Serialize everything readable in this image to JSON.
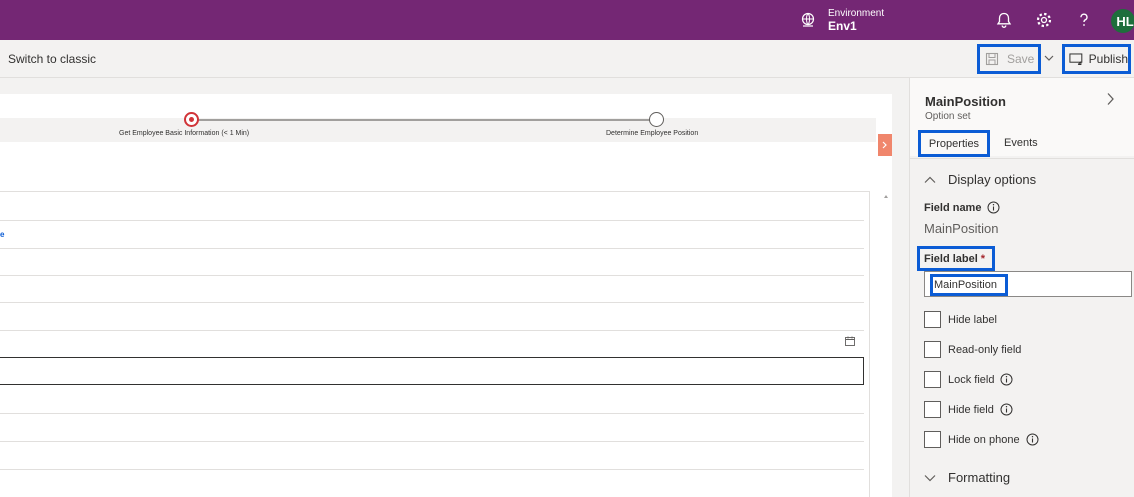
{
  "header": {
    "environment_label": "Environment",
    "environment_name": "Env1",
    "avatar_initials": "HL",
    "accent_color": "#742774"
  },
  "commandbar": {
    "switch_classic": "Switch to classic",
    "save_label": "Save",
    "publish_label": "Publish"
  },
  "form": {
    "stages": [
      {
        "label": "Get Employee Basic Information   (< 1 Min)",
        "status": "active"
      },
      {
        "label": "Determine Employee Position",
        "status": "inactive"
      }
    ],
    "link_fragment": "e"
  },
  "panel": {
    "title": "MainPosition",
    "subtitle": "Option set",
    "tabs": [
      "Properties",
      "Events"
    ],
    "display_options": "Display options",
    "field_name_label": "Field name",
    "field_name_value": "MainPosition",
    "field_label_label": "Field label",
    "field_label_required": "*",
    "field_label_value": "MainPosition",
    "checkboxes": [
      "Hide label",
      "Read-only field",
      "Lock field",
      "Hide field",
      "Hide on phone"
    ],
    "formatting": "Formatting"
  }
}
